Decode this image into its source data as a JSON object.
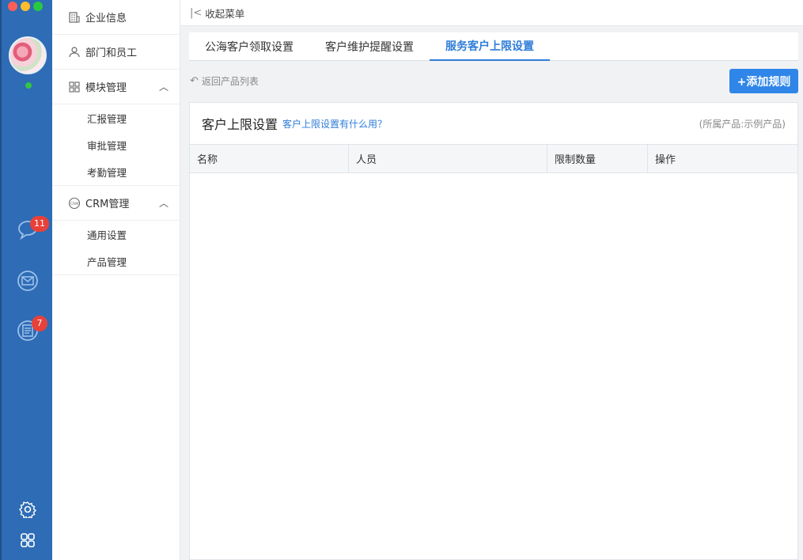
{
  "rail": {
    "chat_badge": "11",
    "notes_badge": "7"
  },
  "menu": {
    "company_info": "企业信息",
    "dept_staff": "部门和员工",
    "module_mgmt": "模块管理",
    "module_items": [
      "汇报管理",
      "审批管理",
      "考勤管理"
    ],
    "crm_mgmt": "CRM管理",
    "crm_items": [
      "通用设置",
      "产品管理"
    ]
  },
  "topbar": {
    "collapse_label": "收起菜单"
  },
  "tabs": [
    "公海客户领取设置",
    "客户维护提醒设置",
    "服务客户上限设置"
  ],
  "active_tab": 2,
  "toolbar": {
    "back_label": "返回产品列表",
    "add_label": "+添加规则"
  },
  "card": {
    "title": "客户上限设置",
    "help_link": "客户上限设置有什么用？",
    "product_note": "(所属产品:示例产品)"
  },
  "table": {
    "columns": [
      "名称",
      "人员",
      "限制数量",
      "操作"
    ],
    "rows": []
  },
  "colors": {
    "accent": "#2f7dd8",
    "rail": "#2e6cb5",
    "badge": "#e8413a",
    "button": "#2f86e8"
  }
}
